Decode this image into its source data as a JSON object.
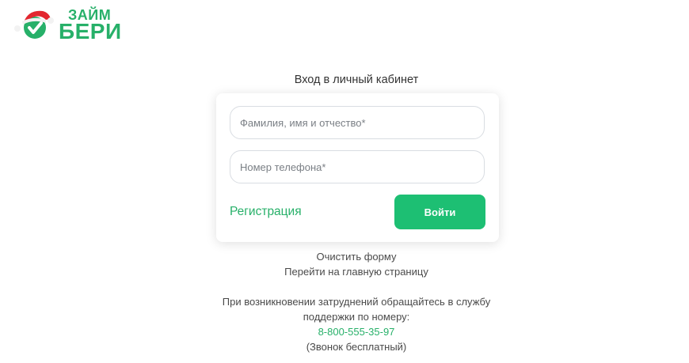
{
  "logo": {
    "line1": "ЗАЙМ",
    "line2": "БЕРИ",
    "brand_color": "#27b069",
    "icon": "santa-hat-checkmark-icon"
  },
  "login": {
    "title": "Вход в личный кабинет",
    "name_placeholder": "Фамилия, имя и отчество*",
    "phone_placeholder": "Номер телефона*",
    "register_label": "Регистрация",
    "submit_label": "Войти",
    "accent_color": "#1dbf73"
  },
  "links": {
    "clear_form": "Очистить форму",
    "home_page": "Перейти на главную страницу"
  },
  "support": {
    "line1": "При возникновении затруднений обращайтесь в службу",
    "line2": "поддержки по номеру:",
    "phone": "8-800-555-35-97",
    "note": "(Звонок бесплатный)"
  }
}
